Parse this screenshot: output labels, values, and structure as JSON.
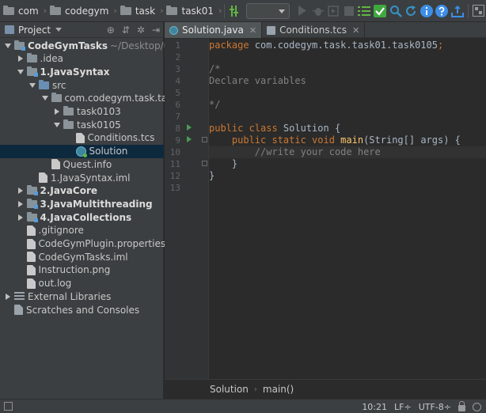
{
  "navbar": {
    "crumbs": [
      "com",
      "codegym",
      "task",
      "task01"
    ],
    "run_config_value": ""
  },
  "toolbar": {
    "icons": [
      "build-icon",
      "run-config-dropdown",
      "run-icon",
      "debug-icon",
      "coverage-icon",
      "stop-icon",
      "todo-list-icon",
      "checkmark-icon",
      "search-icon",
      "refresh-icon",
      "info-icon",
      "help-icon",
      "upload-icon",
      "project-structure-icon"
    ],
    "colors": {
      "green": "#62b543",
      "blue": "#3592c4",
      "info_blue": "#3d8ee8"
    }
  },
  "project": {
    "title": "Project",
    "tree": [
      {
        "label": "CodeGymTasks",
        "hint": "~/Desktop/ur",
        "depth": 0,
        "state": "open",
        "icon": "module-folder",
        "bold": true
      },
      {
        "label": ".idea",
        "depth": 1,
        "state": "closed",
        "icon": "folder"
      },
      {
        "label": "1.JavaSyntax",
        "depth": 1,
        "state": "open",
        "icon": "module-folder",
        "bold": true
      },
      {
        "label": "src",
        "depth": 2,
        "state": "open",
        "icon": "source-folder"
      },
      {
        "label": "com.codegym.task.tas",
        "depth": 3,
        "state": "open",
        "icon": "package"
      },
      {
        "label": "task0103",
        "depth": 4,
        "state": "closed",
        "icon": "package"
      },
      {
        "label": "task0105",
        "depth": 4,
        "state": "open",
        "icon": "package"
      },
      {
        "label": "Conditions.tcs",
        "depth": 5,
        "state": "none",
        "icon": "file"
      },
      {
        "label": "Solution",
        "depth": 5,
        "state": "none",
        "icon": "class",
        "selected": true
      },
      {
        "label": "Quest.info",
        "depth": 3,
        "state": "none",
        "icon": "file"
      },
      {
        "label": "1.JavaSyntax.iml",
        "depth": 2,
        "state": "none",
        "icon": "file"
      },
      {
        "label": "2.JavaCore",
        "depth": 1,
        "state": "closed",
        "icon": "module-folder",
        "bold": true
      },
      {
        "label": "3.JavaMultithreading",
        "depth": 1,
        "state": "closed",
        "icon": "module-folder",
        "bold": true
      },
      {
        "label": "4.JavaCollections",
        "depth": 1,
        "state": "closed",
        "icon": "module-folder",
        "bold": true
      },
      {
        "label": ".gitignore",
        "depth": 1,
        "state": "none",
        "icon": "file"
      },
      {
        "label": "CodeGymPlugin.properties",
        "depth": 1,
        "state": "none",
        "icon": "file"
      },
      {
        "label": "CodeGymTasks.iml",
        "depth": 1,
        "state": "none",
        "icon": "file"
      },
      {
        "label": "Instruction.png",
        "depth": 1,
        "state": "none",
        "icon": "file"
      },
      {
        "label": "out.log",
        "depth": 1,
        "state": "none",
        "icon": "file"
      },
      {
        "label": "External Libraries",
        "depth": 0,
        "state": "closed",
        "icon": "libraries"
      },
      {
        "label": "Scratches and Consoles",
        "depth": 0,
        "state": "none",
        "icon": "scratches"
      }
    ]
  },
  "editor": {
    "tabs": [
      {
        "label": "Solution.java",
        "active": true,
        "icon": "class"
      },
      {
        "label": "Conditions.tcs",
        "active": false,
        "icon": "file"
      }
    ],
    "line_numbers": [
      "1",
      "2",
      "3",
      "4",
      "5",
      "6",
      "7",
      "8",
      "9",
      "10",
      "11",
      "12",
      "13"
    ],
    "lines": [
      [
        {
          "t": "package ",
          "c": "kw"
        },
        {
          "t": "com.codegym.task.task01.task0105",
          "c": "pl"
        },
        {
          "t": ";",
          "c": "kw"
        }
      ],
      [],
      [
        {
          "t": "/*",
          "c": "cm"
        }
      ],
      [
        {
          "t": "Declare variables",
          "c": "cm"
        }
      ],
      [],
      [
        {
          "t": "*/",
          "c": "cm"
        }
      ],
      [],
      [
        {
          "t": "public class ",
          "c": "kw"
        },
        {
          "t": "Solution {",
          "c": "pl"
        }
      ],
      [
        {
          "t": "    public static void ",
          "c": "kw"
        },
        {
          "t": "main",
          "c": "fn"
        },
        {
          "t": "(String[] args) {",
          "c": "pl"
        }
      ],
      [
        {
          "t": "        //write your code here",
          "c": "cm"
        }
      ],
      [
        {
          "t": "    }",
          "c": "pl"
        }
      ],
      [
        {
          "t": "}",
          "c": "pl"
        }
      ],
      []
    ],
    "current_line": 10,
    "breadcrumb": [
      "Solution",
      "main()"
    ]
  },
  "status": {
    "position": "10:21",
    "line_sep": "LF",
    "encoding": "UTF-8"
  }
}
